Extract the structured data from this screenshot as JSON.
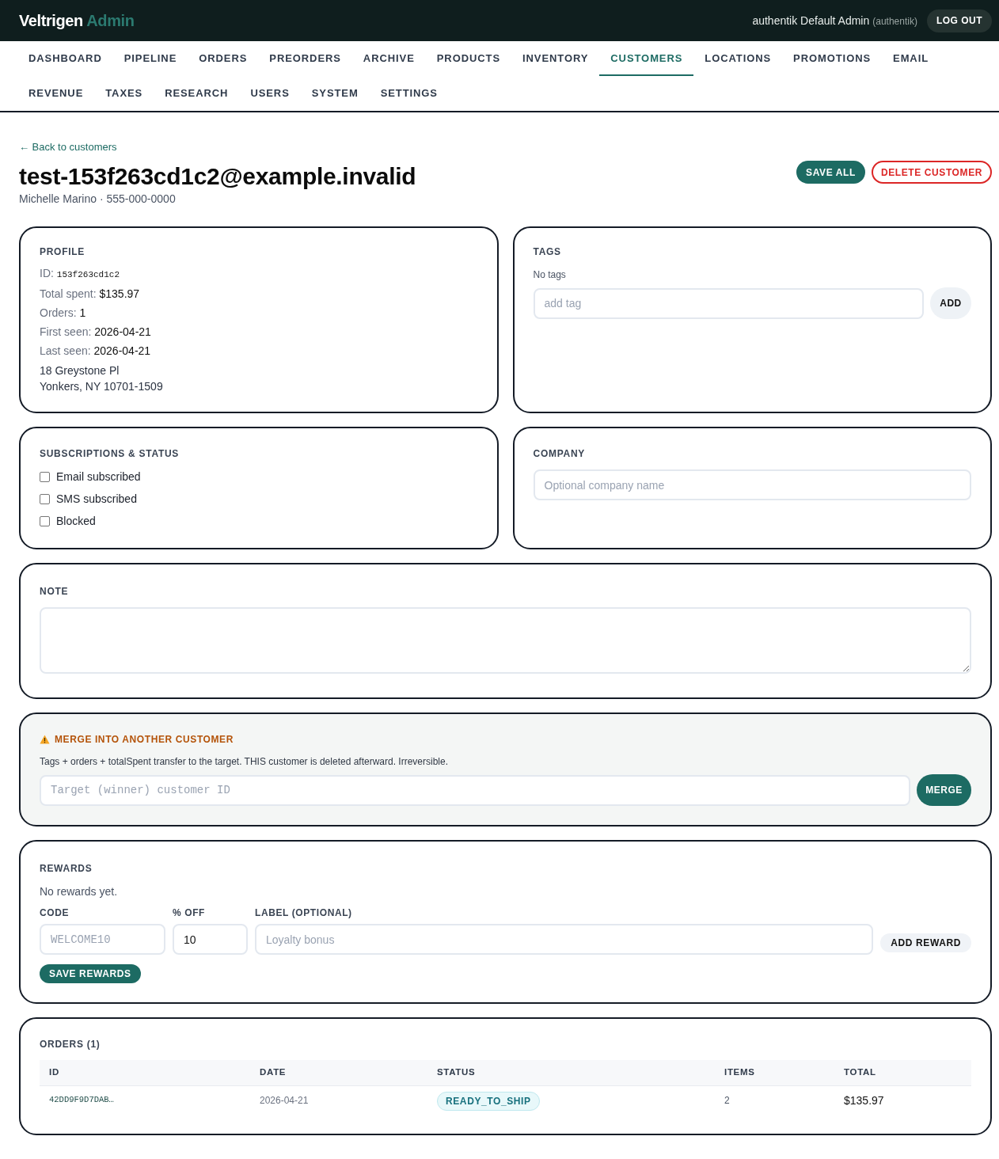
{
  "header": {
    "brand": "Veltrigen",
    "brand_accent": "Admin",
    "user_name": "authentik Default Admin",
    "user_source": "(authentik)",
    "logout": "LOG OUT"
  },
  "nav": [
    {
      "label": "DASHBOARD",
      "selected": false
    },
    {
      "label": "PIPELINE",
      "selected": false
    },
    {
      "label": "ORDERS",
      "selected": false
    },
    {
      "label": "PREORDERS",
      "selected": false
    },
    {
      "label": "ARCHIVE",
      "selected": false
    },
    {
      "label": "PRODUCTS",
      "selected": false
    },
    {
      "label": "INVENTORY",
      "selected": false
    },
    {
      "label": "CUSTOMERS",
      "selected": true
    },
    {
      "label": "LOCATIONS",
      "selected": false
    },
    {
      "label": "PROMOTIONS",
      "selected": false
    },
    {
      "label": "EMAIL",
      "selected": false
    },
    {
      "label": "REVENUE",
      "selected": false
    },
    {
      "label": "TAXES",
      "selected": false
    },
    {
      "label": "RESEARCH",
      "selected": false
    },
    {
      "label": "USERS",
      "selected": false
    },
    {
      "label": "SYSTEM",
      "selected": false
    },
    {
      "label": "SETTINGS",
      "selected": false
    }
  ],
  "back_link": "← Back to customers",
  "title": "test-153f263cd1c2@example.invalid",
  "subtitle": "Michelle Marino · 555-000-0000",
  "actions": [
    {
      "label": "SAVE ALL",
      "kind": "primary"
    },
    {
      "label": "DELETE CUSTOMER",
      "kind": "danger"
    }
  ],
  "profile": {
    "heading": "PROFILE",
    "fields": [
      {
        "label": "ID:",
        "value": "153f263cd1c2",
        "kind": "code"
      },
      {
        "label": "Total spent:",
        "value": "$135.97",
        "kind": "text"
      },
      {
        "label": "Orders:",
        "value": "1",
        "kind": "text"
      },
      {
        "label": "First seen:",
        "value": "2026-04-21",
        "kind": "text"
      },
      {
        "label": "Last seen:",
        "value": "2026-04-21",
        "kind": "text"
      }
    ],
    "address": [
      "18 Greystone Pl",
      "Yonkers, NY 10701-1509"
    ]
  },
  "tags": {
    "heading": "TAGS",
    "empty_text": "No tags",
    "input": {
      "placeholder": "add tag"
    },
    "button": "ADD"
  },
  "subscriptions": {
    "heading": "SUBSCRIPTIONS & STATUS",
    "options": [
      {
        "label": "Email subscribed",
        "checked": false
      },
      {
        "label": "SMS subscribed",
        "checked": false
      },
      {
        "label": "Blocked",
        "checked": false
      }
    ]
  },
  "company": {
    "heading": "COMPANY",
    "input": {
      "placeholder": "Optional company name"
    }
  },
  "note": {
    "heading": "NOTE"
  },
  "merge": {
    "heading": "MERGE INTO ANOTHER CUSTOMER",
    "description": "Tags + orders + totalSpent transfer to the target. THIS customer is deleted afterward. Irreversible.",
    "input": {
      "placeholder": "Target (winner) customer ID"
    },
    "button": "MERGE"
  },
  "rewards": {
    "heading": "REWARDS",
    "empty_text": "No rewards yet.",
    "fields": [
      {
        "label": "CODE",
        "placeholder": "WELCOME10",
        "kind": "code"
      },
      {
        "label": "% OFF",
        "value": "10",
        "kind": "number"
      },
      {
        "label": "LABEL (OPTIONAL)",
        "placeholder": "Loyalty bonus",
        "kind": "text"
      }
    ],
    "add_button": "ADD REWARD",
    "save_button": "SAVE REWARDS"
  },
  "orders": {
    "heading": "ORDERS (1)",
    "columns": [
      "ID",
      "DATE",
      "STATUS",
      "ITEMS",
      "TOTAL"
    ],
    "rows": [
      {
        "id": "42DD9F9D7DAB…",
        "date": "2026-04-21",
        "status": "READY_TO_SHIP",
        "items": "2",
        "total": "$135.97"
      }
    ]
  }
}
